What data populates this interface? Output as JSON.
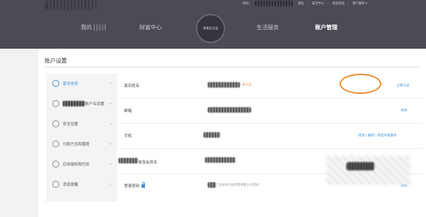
{
  "header": {
    "top_links": [
      "退出",
      "安全中心",
      "会员权益",
      "客户服务 ▾"
    ],
    "top_welcome": "你好，",
    "nav": {
      "my_label": "我的",
      "wealth": "财富中心",
      "center": "未来在认证",
      "life": "生活服务",
      "account": "账户管理"
    }
  },
  "page": {
    "title": "账户设置"
  },
  "sidebar": {
    "items": [
      {
        "label": "基本信息",
        "icon": "user-icon"
      },
      {
        "label": "账户名设置",
        "icon": "id-icon"
      },
      {
        "label": "安全设置",
        "icon": "shield-icon"
      },
      {
        "label": "付款方式和额度",
        "icon": "payment-icon"
      },
      {
        "label": "应用授权和代扣",
        "icon": "check-icon"
      },
      {
        "label": "消息提醒",
        "icon": "bell-icon"
      }
    ]
  },
  "rows": [
    {
      "label": "真实姓名",
      "status": "未认证",
      "action": "立即认证"
    },
    {
      "label": "邮箱",
      "action": "修改"
    },
    {
      "label": "手机",
      "action": "修改 | 解绑 | 开启手机服务"
    },
    {
      "label": "淘宝会员名"
    },
    {
      "label": "登录密码",
      "hint": "登录本产品时需要输入的密码",
      "action": "重置"
    }
  ]
}
